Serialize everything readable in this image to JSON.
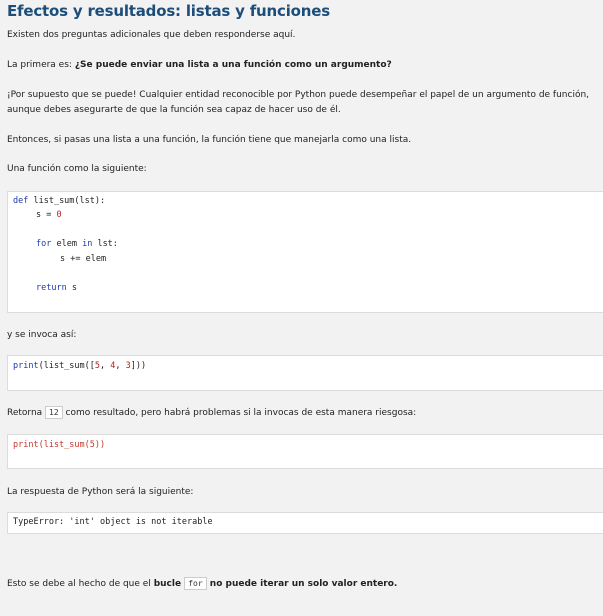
{
  "title": "Efectos y resultados: listas y funciones",
  "intro": "Existen dos preguntas adicionales que deben responderse aquí.",
  "q_prefix": "La primera es: ",
  "q_bold": "¿Se puede enviar una lista a una función como un argumento?",
  "answer_line1": "¡Por supuesto que se puede! Cualquier entidad reconocible por Python puede desempeñar el papel de un argumento de función,",
  "answer_line2": "aunque debes asegurarte de que la función sea capaz de hacer uso de él.",
  "then_text": "Entonces, si pasas una lista a una función, la función tiene que manejarla como una lista.",
  "func_intro": "Una función como la siguiente:",
  "code1": {
    "def": "def",
    "sig": " list_sum(lst):",
    "s_assign": "s = ",
    "zero": "0",
    "for_kw": "for",
    "for_mid": " elem ",
    "in_kw": "in",
    "for_end": " lst:",
    "accum": "s += elem",
    "return_kw": "return",
    "return_val": " s"
  },
  "invoke_text": "y se invoca así:",
  "code2": {
    "print": "print",
    "call": "(list_sum([",
    "n1": "5",
    "sep1": ", ",
    "n2": "4",
    "sep2": ", ",
    "n3": "3",
    "end": "]))"
  },
  "returns_prefix": "Retorna ",
  "returns_value": "12",
  "returns_suffix": " como resultado, pero habrá problemas si la invocas de esta manera riesgosa:",
  "code3": "print(list_sum(5))",
  "python_response": "La respuesta de Python será la siguiente:",
  "error_text": "TypeError: 'int' object is not iterable",
  "final_prefix": "Esto se debe al hecho de que el ",
  "final_bold1": "bucle ",
  "final_code": "for",
  "final_bold2": " no puede iterar un solo valor entero."
}
